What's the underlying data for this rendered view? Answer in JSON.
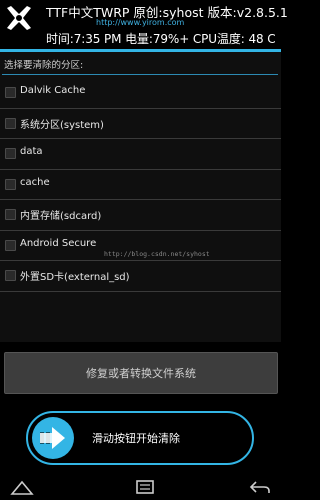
{
  "header": {
    "title": "TTF中文TWRP 原创:syhost 版本:v2.8.5.1",
    "url": "http://www.yirom.com",
    "status": "时间:7:35 PM  电量:79%+  CPU温度: 48 C"
  },
  "wipe": {
    "section_label": "选择要清除的分区:",
    "partitions": [
      {
        "label": "Dalvik Cache"
      },
      {
        "label": "系统分区(system)"
      },
      {
        "label": "data"
      },
      {
        "label": "cache"
      },
      {
        "label": "内置存储(sdcard)"
      },
      {
        "label": "Android Secure"
      },
      {
        "label": "外置SD卡(external_sd)"
      }
    ],
    "watermark": "http://blog.csdn.net/syhost",
    "repair_button": "修复或者转换文件系统",
    "slider_label": "滑动按钮开始清除"
  },
  "colors": {
    "accent": "#33b5e5"
  },
  "icons": {
    "logo": "ttf-twrp-logo-icon",
    "slider": "chevron-right-icon",
    "nav_home": "home-icon",
    "nav_menu": "menu-icon",
    "nav_back": "back-icon"
  }
}
